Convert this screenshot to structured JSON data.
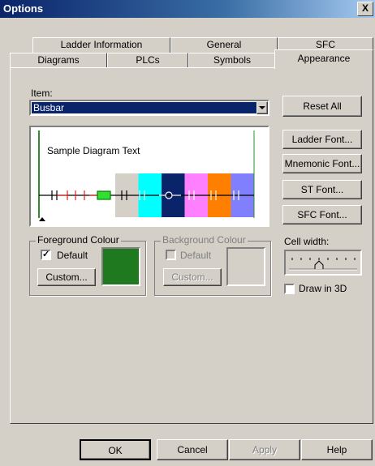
{
  "window": {
    "title": "Options",
    "close_glyph": "X"
  },
  "tabs": {
    "back_row": [
      "Ladder Information",
      "General",
      "SFC"
    ],
    "front_row": [
      "Diagrams",
      "PLCs",
      "Symbols",
      "Appearance"
    ],
    "active": "Appearance"
  },
  "appearance": {
    "item_label": "Item:",
    "item_value": "Busbar",
    "preview_sample_text": "Sample Diagram Text",
    "preview_blocks": [
      "#d4d0c8",
      "#00ffff",
      "#0a246a",
      "#ff80ff",
      "#ff8000",
      "#8080ff"
    ],
    "foreground": {
      "legend": "Foreground Colour",
      "default_label": "Default",
      "default_checked": true,
      "custom_label": "Custom...",
      "swatch_color": "#1f7a1f"
    },
    "background": {
      "legend": "Background Colour",
      "default_label": "Default",
      "default_checked": false,
      "custom_label": "Custom...",
      "swatch_color": "#d4d0c8"
    },
    "buttons": [
      "Reset All",
      "Ladder Font...",
      "Mnemonic Font...",
      "ST Font...",
      "SFC Font..."
    ],
    "cell_width_label": "Cell width:",
    "draw_3d_label": "Draw in 3D",
    "draw_3d_checked": false
  },
  "footer": {
    "ok": "OK",
    "cancel": "Cancel",
    "apply": "Apply",
    "help": "Help"
  }
}
